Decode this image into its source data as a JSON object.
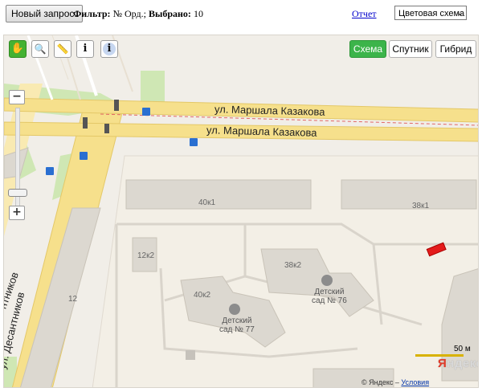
{
  "toolbar": {
    "new_query_label": "Новый запрос.",
    "filter_label": "Фильтр:",
    "filter_value": "№ Орд.;",
    "selected_label": "Выбрано:",
    "selected_value": "10",
    "report_link": "Отчет",
    "color_scheme_value": "Цветовая схема"
  },
  "map_tools": [
    {
      "name": "hand-tool",
      "icon": "hand-icon"
    },
    {
      "name": "zoom-area-tool",
      "icon": "magnifier-icon"
    },
    {
      "name": "ruler-tool",
      "icon": "ruler-icon"
    },
    {
      "name": "info-tool",
      "icon": "info-icon",
      "glyph": "i"
    },
    {
      "name": "info-alt-tool",
      "icon": "info-circle-icon",
      "glyph": "i"
    }
  ],
  "map_types": {
    "scheme": "Схема",
    "satellite": "Спутник",
    "hybrid": "Гибрид"
  },
  "map": {
    "street_upper": "ул. Маршала Казакова",
    "street_lower": "ул. Маршала Казакова",
    "street_vertical": "ул. Десантников",
    "street_vertical_cut": "нтников",
    "buildings": [
      "40к1",
      "38к1",
      "12к2",
      "38к2",
      "40к2",
      "12"
    ],
    "kindergarten_1": [
      "Детский",
      "сад № 76"
    ],
    "kindergarten_2": [
      "Детский",
      "сад № 77"
    ],
    "scale_text": "50 м",
    "logo": "Яндекс",
    "copyright_prefix": "© Яндекс –",
    "terms_link": "Условия использования"
  },
  "colors": {
    "accent_green": "#3cb44a",
    "road_yellow": "#f6e08c",
    "selection_red": "#e41b1b",
    "link_blue": "#0000cc"
  }
}
